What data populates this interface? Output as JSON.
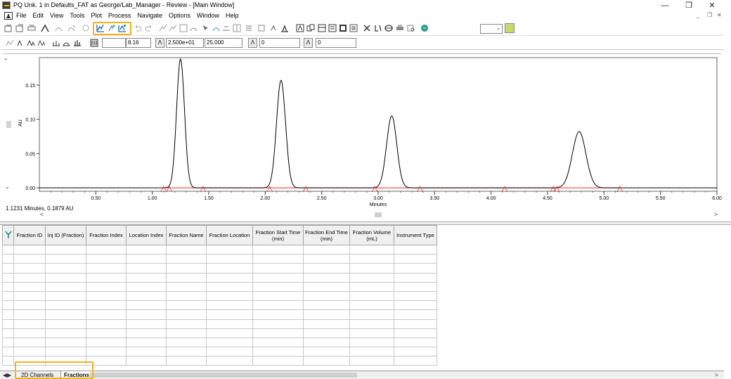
{
  "window": {
    "title": "PQ Unk. 1 in Defaults_FAT as George/Lab_Manager - Review - [Main Window]",
    "controls": [
      "—",
      "❐",
      "✕"
    ],
    "mdi_controls": [
      "_",
      "❐",
      "✕"
    ]
  },
  "menu": [
    "File",
    "Edit",
    "View",
    "Tools",
    "Plot",
    "Process",
    "Navigate",
    "Options",
    "Window",
    "Help"
  ],
  "toolbar2": {
    "field_blank": "",
    "field_time": "8.16",
    "field_au": "2.500e+01",
    "field_au2": "25.000",
    "field_a": "0",
    "field_b": "0"
  },
  "toolbar1_combo": "",
  "status": "1.1231 Minutes, 0.1879 AU",
  "chart_data": {
    "type": "line",
    "xlabel": "Minutes",
    "ylabel": "AU",
    "xlim": [
      0.0,
      6.0
    ],
    "ylim": [
      -0.005,
      0.19
    ],
    "x_ticks": [
      "0.50",
      "1.00",
      "1.50",
      "2.00",
      "2.50",
      "3.00",
      "3.50",
      "4.00",
      "4.50",
      "5.00",
      "5.50",
      "6.00"
    ],
    "y_ticks": [
      "0.00",
      "0.05",
      "0.10",
      "0.15"
    ],
    "peaks": [
      {
        "time": 1.25,
        "height": 0.188,
        "width": 0.035
      },
      {
        "time": 2.14,
        "height": 0.157,
        "width": 0.04
      },
      {
        "time": 3.12,
        "height": 0.105,
        "width": 0.045
      },
      {
        "time": 4.78,
        "height": 0.082,
        "width": 0.06
      }
    ],
    "baseline_markers": [
      1.1,
      1.15,
      1.45,
      2.04,
      2.36,
      2.97,
      3.37,
      4.12,
      4.55,
      4.58,
      5.14
    ],
    "line_color": "#000000",
    "baseline_color": "#e8322b",
    "grid": false
  },
  "table": {
    "columns": [
      "Fraction ID",
      "Inj ID (Fraction)",
      "Fraction Index",
      "Location Index",
      "Fraction Name",
      "Fraction Location",
      "Fraction Start Time (min)",
      "Fraction End Time (min)",
      "Fraction Volume (mL)",
      "Instrument Type"
    ],
    "empty_rows": 13
  },
  "tabs": [
    "2D Channels",
    "Fractions"
  ],
  "active_tab": "Fractions",
  "highlight_color": "#f2b21a"
}
